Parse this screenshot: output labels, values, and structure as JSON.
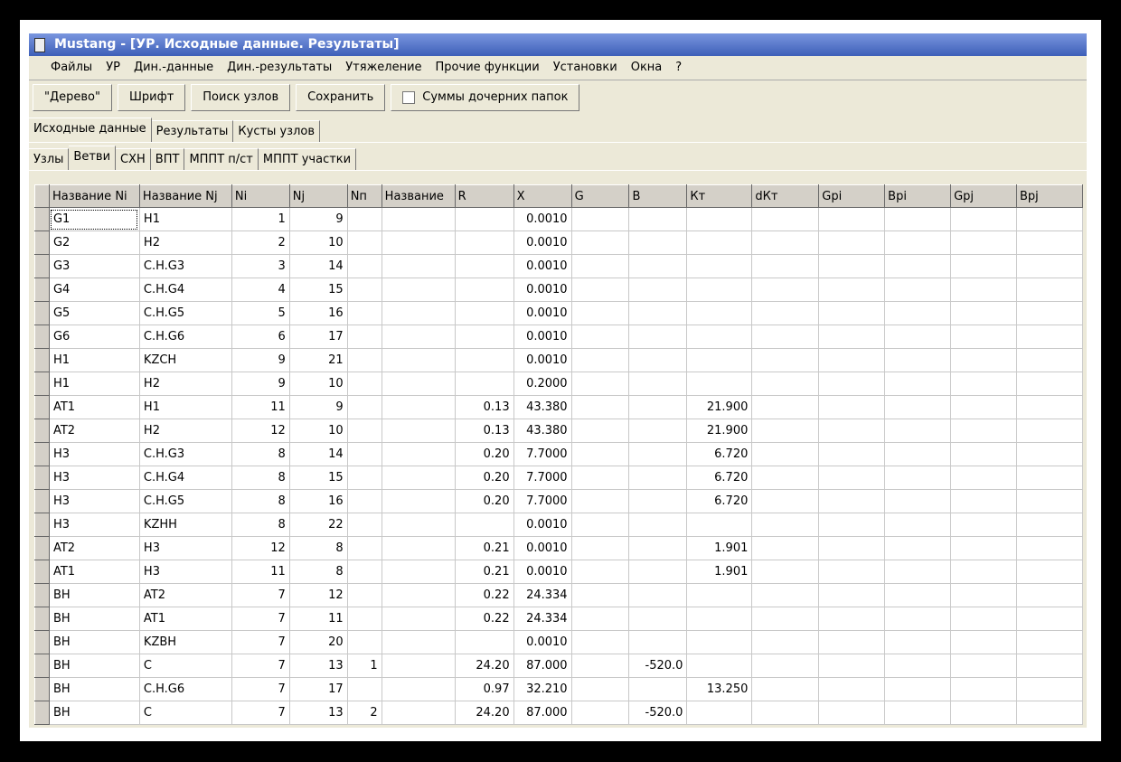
{
  "window": {
    "title": "Mustang - [УР. Исходные данные. Результаты]"
  },
  "menu": [
    "Файлы",
    "УР",
    "Дин.-данные",
    "Дин.-результаты",
    "Утяжеление",
    "Прочие функции",
    "Установки",
    "Окна",
    "?"
  ],
  "toolbar": {
    "tree": "\"Дерево\"",
    "font": "Шрифт",
    "search": "Поиск узлов",
    "save": "Сохранить",
    "sums": "Суммы дочерних папок"
  },
  "tabs1": [
    "Исходные данные",
    "Результаты",
    "Кусты узлов"
  ],
  "tabs2": [
    "Узлы",
    "Ветви",
    "СХН",
    "ВПТ",
    "МППТ п/ст",
    "МППТ участки"
  ],
  "columns": [
    "Название Ni",
    "Название Nj",
    "Ni",
    "Nj",
    "Nп",
    "Название",
    "R",
    "X",
    "G",
    "B",
    "Кт",
    "dКт",
    "Gpi",
    "Bpi",
    "Gpj",
    "Bpj"
  ],
  "rows": [
    [
      "G1",
      "H1",
      "1",
      "9",
      "",
      "",
      "",
      "0.0010",
      "",
      "",
      "",
      "",
      "",
      "",
      "",
      ""
    ],
    [
      "G2",
      "H2",
      "2",
      "10",
      "",
      "",
      "",
      "0.0010",
      "",
      "",
      "",
      "",
      "",
      "",
      "",
      ""
    ],
    [
      "G3",
      "C.H.G3",
      "3",
      "14",
      "",
      "",
      "",
      "0.0010",
      "",
      "",
      "",
      "",
      "",
      "",
      "",
      ""
    ],
    [
      "G4",
      "C.H.G4",
      "4",
      "15",
      "",
      "",
      "",
      "0.0010",
      "",
      "",
      "",
      "",
      "",
      "",
      "",
      ""
    ],
    [
      "G5",
      "C.H.G5",
      "5",
      "16",
      "",
      "",
      "",
      "0.0010",
      "",
      "",
      "",
      "",
      "",
      "",
      "",
      ""
    ],
    [
      "G6",
      "C.H.G6",
      "6",
      "17",
      "",
      "",
      "",
      "0.0010",
      "",
      "",
      "",
      "",
      "",
      "",
      "",
      ""
    ],
    [
      "H1",
      "KZCH",
      "9",
      "21",
      "",
      "",
      "",
      "0.0010",
      "",
      "",
      "",
      "",
      "",
      "",
      "",
      ""
    ],
    [
      "H1",
      "H2",
      "9",
      "10",
      "",
      "",
      "",
      "0.2000",
      "",
      "",
      "",
      "",
      "",
      "",
      "",
      ""
    ],
    [
      "AT1",
      "H1",
      "11",
      "9",
      "",
      "",
      "0.13",
      "43.380",
      "",
      "",
      "21.900",
      "",
      "",
      "",
      "",
      ""
    ],
    [
      "AT2",
      "H2",
      "12",
      "10",
      "",
      "",
      "0.13",
      "43.380",
      "",
      "",
      "21.900",
      "",
      "",
      "",
      "",
      ""
    ],
    [
      "H3",
      "C.H.G3",
      "8",
      "14",
      "",
      "",
      "0.20",
      "7.7000",
      "",
      "",
      "6.720",
      "",
      "",
      "",
      "",
      ""
    ],
    [
      "H3",
      "C.H.G4",
      "8",
      "15",
      "",
      "",
      "0.20",
      "7.7000",
      "",
      "",
      "6.720",
      "",
      "",
      "",
      "",
      ""
    ],
    [
      "H3",
      "C.H.G5",
      "8",
      "16",
      "",
      "",
      "0.20",
      "7.7000",
      "",
      "",
      "6.720",
      "",
      "",
      "",
      "",
      ""
    ],
    [
      "H3",
      "KZHH",
      "8",
      "22",
      "",
      "",
      "",
      "0.0010",
      "",
      "",
      "",
      "",
      "",
      "",
      "",
      ""
    ],
    [
      "AT2",
      "H3",
      "12",
      "8",
      "",
      "",
      "0.21",
      "0.0010",
      "",
      "",
      "1.901",
      "",
      "",
      "",
      "",
      ""
    ],
    [
      "AT1",
      "H3",
      "11",
      "8",
      "",
      "",
      "0.21",
      "0.0010",
      "",
      "",
      "1.901",
      "",
      "",
      "",
      "",
      ""
    ],
    [
      "BH",
      "AT2",
      "7",
      "12",
      "",
      "",
      "0.22",
      "24.334",
      "",
      "",
      "",
      "",
      "",
      "",
      "",
      ""
    ],
    [
      "BH",
      "AT1",
      "7",
      "11",
      "",
      "",
      "0.22",
      "24.334",
      "",
      "",
      "",
      "",
      "",
      "",
      "",
      ""
    ],
    [
      "BH",
      "KZBH",
      "7",
      "20",
      "",
      "",
      "",
      "0.0010",
      "",
      "",
      "",
      "",
      "",
      "",
      "",
      ""
    ],
    [
      "BH",
      "C",
      "7",
      "13",
      "1",
      "",
      "24.20",
      "87.000",
      "",
      "-520.0",
      "",
      "",
      "",
      "",
      "",
      ""
    ],
    [
      "BH",
      "C.H.G6",
      "7",
      "17",
      "",
      "",
      "0.97",
      "32.210",
      "",
      "",
      "13.250",
      "",
      "",
      "",
      "",
      ""
    ],
    [
      "BH",
      "C",
      "7",
      "13",
      "2",
      "",
      "24.20",
      "87.000",
      "",
      "-520.0",
      "",
      "",
      "",
      "",
      "",
      ""
    ]
  ]
}
